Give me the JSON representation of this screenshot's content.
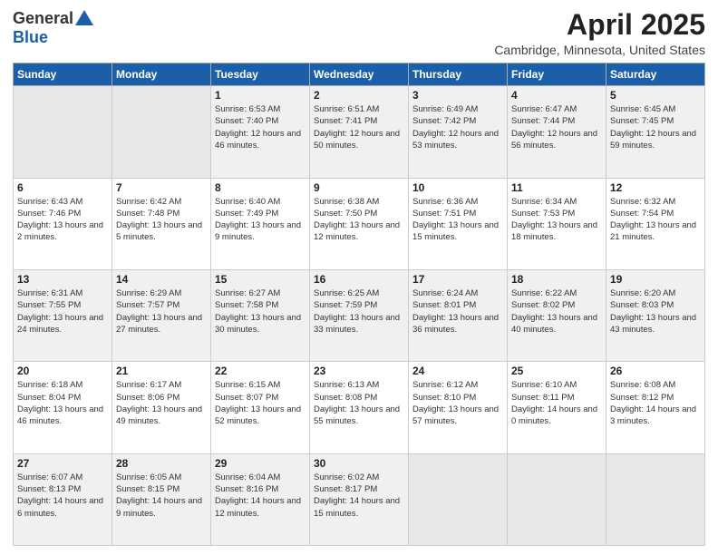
{
  "logo": {
    "general": "General",
    "blue": "Blue"
  },
  "header": {
    "title": "April 2025",
    "subtitle": "Cambridge, Minnesota, United States"
  },
  "days_of_week": [
    "Sunday",
    "Monday",
    "Tuesday",
    "Wednesday",
    "Thursday",
    "Friday",
    "Saturday"
  ],
  "weeks": [
    [
      {
        "day": "",
        "empty": true
      },
      {
        "day": "",
        "empty": true
      },
      {
        "day": "1",
        "sunrise": "Sunrise: 6:53 AM",
        "sunset": "Sunset: 7:40 PM",
        "daylight": "Daylight: 12 hours and 46 minutes."
      },
      {
        "day": "2",
        "sunrise": "Sunrise: 6:51 AM",
        "sunset": "Sunset: 7:41 PM",
        "daylight": "Daylight: 12 hours and 50 minutes."
      },
      {
        "day": "3",
        "sunrise": "Sunrise: 6:49 AM",
        "sunset": "Sunset: 7:42 PM",
        "daylight": "Daylight: 12 hours and 53 minutes."
      },
      {
        "day": "4",
        "sunrise": "Sunrise: 6:47 AM",
        "sunset": "Sunset: 7:44 PM",
        "daylight": "Daylight: 12 hours and 56 minutes."
      },
      {
        "day": "5",
        "sunrise": "Sunrise: 6:45 AM",
        "sunset": "Sunset: 7:45 PM",
        "daylight": "Daylight: 12 hours and 59 minutes."
      }
    ],
    [
      {
        "day": "6",
        "sunrise": "Sunrise: 6:43 AM",
        "sunset": "Sunset: 7:46 PM",
        "daylight": "Daylight: 13 hours and 2 minutes."
      },
      {
        "day": "7",
        "sunrise": "Sunrise: 6:42 AM",
        "sunset": "Sunset: 7:48 PM",
        "daylight": "Daylight: 13 hours and 5 minutes."
      },
      {
        "day": "8",
        "sunrise": "Sunrise: 6:40 AM",
        "sunset": "Sunset: 7:49 PM",
        "daylight": "Daylight: 13 hours and 9 minutes."
      },
      {
        "day": "9",
        "sunrise": "Sunrise: 6:38 AM",
        "sunset": "Sunset: 7:50 PM",
        "daylight": "Daylight: 13 hours and 12 minutes."
      },
      {
        "day": "10",
        "sunrise": "Sunrise: 6:36 AM",
        "sunset": "Sunset: 7:51 PM",
        "daylight": "Daylight: 13 hours and 15 minutes."
      },
      {
        "day": "11",
        "sunrise": "Sunrise: 6:34 AM",
        "sunset": "Sunset: 7:53 PM",
        "daylight": "Daylight: 13 hours and 18 minutes."
      },
      {
        "day": "12",
        "sunrise": "Sunrise: 6:32 AM",
        "sunset": "Sunset: 7:54 PM",
        "daylight": "Daylight: 13 hours and 21 minutes."
      }
    ],
    [
      {
        "day": "13",
        "sunrise": "Sunrise: 6:31 AM",
        "sunset": "Sunset: 7:55 PM",
        "daylight": "Daylight: 13 hours and 24 minutes."
      },
      {
        "day": "14",
        "sunrise": "Sunrise: 6:29 AM",
        "sunset": "Sunset: 7:57 PM",
        "daylight": "Daylight: 13 hours and 27 minutes."
      },
      {
        "day": "15",
        "sunrise": "Sunrise: 6:27 AM",
        "sunset": "Sunset: 7:58 PM",
        "daylight": "Daylight: 13 hours and 30 minutes."
      },
      {
        "day": "16",
        "sunrise": "Sunrise: 6:25 AM",
        "sunset": "Sunset: 7:59 PM",
        "daylight": "Daylight: 13 hours and 33 minutes."
      },
      {
        "day": "17",
        "sunrise": "Sunrise: 6:24 AM",
        "sunset": "Sunset: 8:01 PM",
        "daylight": "Daylight: 13 hours and 36 minutes."
      },
      {
        "day": "18",
        "sunrise": "Sunrise: 6:22 AM",
        "sunset": "Sunset: 8:02 PM",
        "daylight": "Daylight: 13 hours and 40 minutes."
      },
      {
        "day": "19",
        "sunrise": "Sunrise: 6:20 AM",
        "sunset": "Sunset: 8:03 PM",
        "daylight": "Daylight: 13 hours and 43 minutes."
      }
    ],
    [
      {
        "day": "20",
        "sunrise": "Sunrise: 6:18 AM",
        "sunset": "Sunset: 8:04 PM",
        "daylight": "Daylight: 13 hours and 46 minutes."
      },
      {
        "day": "21",
        "sunrise": "Sunrise: 6:17 AM",
        "sunset": "Sunset: 8:06 PM",
        "daylight": "Daylight: 13 hours and 49 minutes."
      },
      {
        "day": "22",
        "sunrise": "Sunrise: 6:15 AM",
        "sunset": "Sunset: 8:07 PM",
        "daylight": "Daylight: 13 hours and 52 minutes."
      },
      {
        "day": "23",
        "sunrise": "Sunrise: 6:13 AM",
        "sunset": "Sunset: 8:08 PM",
        "daylight": "Daylight: 13 hours and 55 minutes."
      },
      {
        "day": "24",
        "sunrise": "Sunrise: 6:12 AM",
        "sunset": "Sunset: 8:10 PM",
        "daylight": "Daylight: 13 hours and 57 minutes."
      },
      {
        "day": "25",
        "sunrise": "Sunrise: 6:10 AM",
        "sunset": "Sunset: 8:11 PM",
        "daylight": "Daylight: 14 hours and 0 minutes."
      },
      {
        "day": "26",
        "sunrise": "Sunrise: 6:08 AM",
        "sunset": "Sunset: 8:12 PM",
        "daylight": "Daylight: 14 hours and 3 minutes."
      }
    ],
    [
      {
        "day": "27",
        "sunrise": "Sunrise: 6:07 AM",
        "sunset": "Sunset: 8:13 PM",
        "daylight": "Daylight: 14 hours and 6 minutes."
      },
      {
        "day": "28",
        "sunrise": "Sunrise: 6:05 AM",
        "sunset": "Sunset: 8:15 PM",
        "daylight": "Daylight: 14 hours and 9 minutes."
      },
      {
        "day": "29",
        "sunrise": "Sunrise: 6:04 AM",
        "sunset": "Sunset: 8:16 PM",
        "daylight": "Daylight: 14 hours and 12 minutes."
      },
      {
        "day": "30",
        "sunrise": "Sunrise: 6:02 AM",
        "sunset": "Sunset: 8:17 PM",
        "daylight": "Daylight: 14 hours and 15 minutes."
      },
      {
        "day": "",
        "empty": true
      },
      {
        "day": "",
        "empty": true
      },
      {
        "day": "",
        "empty": true
      }
    ]
  ]
}
